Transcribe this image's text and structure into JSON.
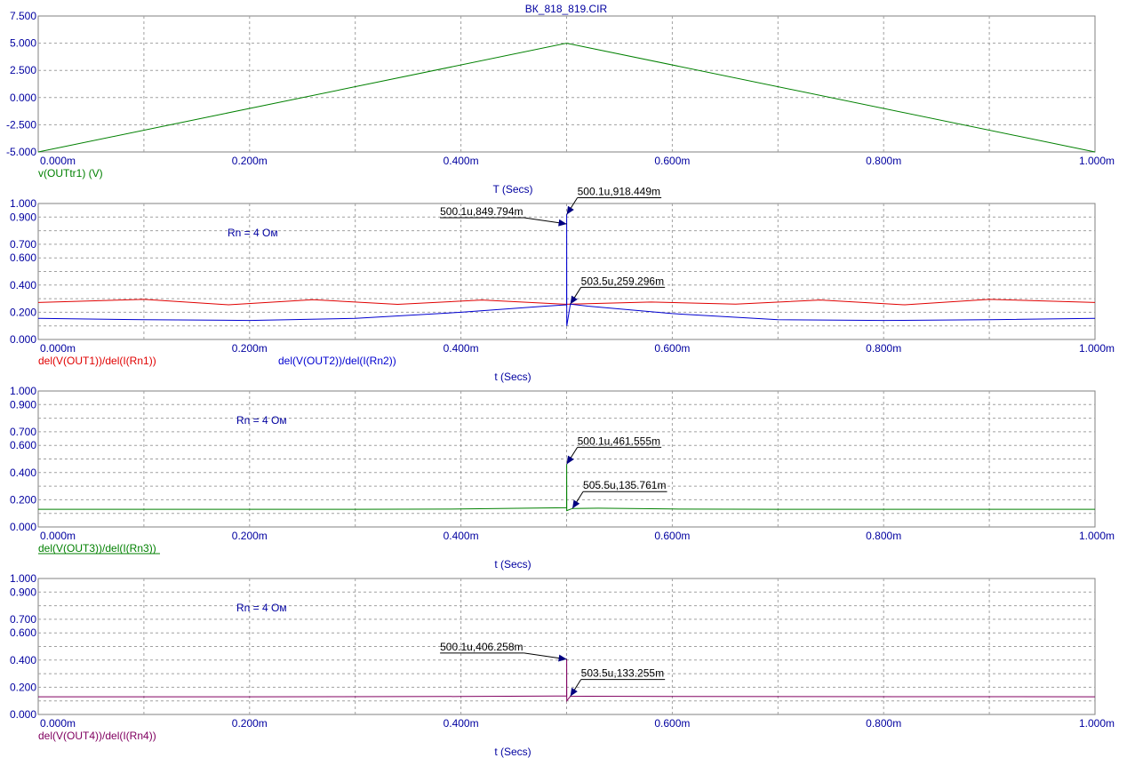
{
  "window": {
    "title": "ВК_818_819.CIR"
  },
  "chart_data": [
    {
      "type": "line",
      "title": "ВК_818_819.CIR",
      "xlabel": "T (Secs)",
      "xlim": [
        0,
        1
      ],
      "ylim": [
        -5,
        7.5
      ],
      "yticks": [
        "7.500",
        "5.000",
        "2.500",
        "0.000",
        "-2.500",
        "-5.000"
      ],
      "ytick_values": [
        7.5,
        5,
        2.5,
        0,
        -2.5,
        -5
      ],
      "xticks": [
        "0.000m",
        "0.200m",
        "0.400m",
        "0.600m",
        "0.800m",
        "1.000m"
      ],
      "xtick_values": [
        0,
        0.2,
        0.4,
        0.6,
        0.8,
        1.0
      ],
      "series": [
        {
          "name": "v(OUTtr1) (V)",
          "color": "#008000",
          "x": [
            0,
            0.5,
            1.0
          ],
          "y": [
            -5,
            5,
            -5
          ]
        }
      ],
      "annotations": []
    },
    {
      "type": "line",
      "xlabel": "t (Secs)",
      "xlim": [
        0,
        1
      ],
      "ylim": [
        0,
        1
      ],
      "yticks": [
        "1.000",
        "0.900",
        "0.700",
        "0.600",
        "0.400",
        "0.200",
        "0.000"
      ],
      "ytick_values": [
        1.0,
        0.9,
        0.7,
        0.6,
        0.4,
        0.2,
        0.0
      ],
      "xticks": [
        "0.000m",
        "0.200m",
        "0.400m",
        "0.600m",
        "0.800m",
        "1.000m"
      ],
      "xtick_values": [
        0,
        0.2,
        0.4,
        0.6,
        0.8,
        1.0
      ],
      "note": "Rn = 4 Ом",
      "series": [
        {
          "name": "del(V(OUT1))/del(I(Rn1))",
          "color": "#e00000",
          "x": [
            0,
            0.1,
            0.18,
            0.26,
            0.34,
            0.42,
            0.5,
            0.58,
            0.66,
            0.74,
            0.82,
            0.9,
            1.0
          ],
          "y": [
            0.272,
            0.295,
            0.255,
            0.292,
            0.258,
            0.29,
            0.259,
            0.275,
            0.26,
            0.29,
            0.255,
            0.295,
            0.272
          ]
        },
        {
          "name": "del(V(OUT2))/del(I(Rn2))",
          "color": "#0000d0",
          "x": [
            0,
            0.1,
            0.2,
            0.3,
            0.4,
            0.48,
            0.5,
            0.5001,
            0.5002,
            0.5035,
            0.52,
            0.6,
            0.7,
            0.8,
            0.9,
            1.0
          ],
          "y": [
            0.155,
            0.145,
            0.14,
            0.155,
            0.2,
            0.245,
            0.255,
            0.918449,
            0.1,
            0.259296,
            0.245,
            0.19,
            0.145,
            0.14,
            0.145,
            0.155
          ]
        }
      ],
      "annotations": [
        {
          "text": "500.1u,849.794m",
          "x": 0.5001,
          "y": 0.849794,
          "side": "left"
        },
        {
          "text": "500.1u,918.449m",
          "x": 0.5001,
          "y": 0.918449,
          "side": "right"
        },
        {
          "text": "503.5u,259.296m",
          "x": 0.5035,
          "y": 0.259296,
          "side": "right"
        }
      ]
    },
    {
      "type": "line",
      "xlabel": "t (Secs)",
      "xlim": [
        0,
        1
      ],
      "ylim": [
        0,
        1
      ],
      "yticks": [
        "1.000",
        "0.900",
        "0.700",
        "0.600",
        "0.400",
        "0.200",
        "0.000"
      ],
      "ytick_values": [
        1.0,
        0.9,
        0.7,
        0.6,
        0.4,
        0.2,
        0.0
      ],
      "xticks": [
        "0.000m",
        "0.200m",
        "0.400m",
        "0.600m",
        "0.800m",
        "1.000m"
      ],
      "xtick_values": [
        0,
        0.2,
        0.4,
        0.6,
        0.8,
        1.0
      ],
      "note": "Rn = 4 Ом",
      "series": [
        {
          "name": "del(V(OUT3))/del(I(Rn3))",
          "color": "#008000",
          "x": [
            0,
            0.3,
            0.4,
            0.48,
            0.5,
            0.5001,
            0.5002,
            0.5055,
            0.53,
            0.6,
            0.7,
            1.0
          ],
          "y": [
            0.13,
            0.13,
            0.132,
            0.14,
            0.142,
            0.461555,
            0.12,
            0.135761,
            0.138,
            0.132,
            0.13,
            0.13
          ]
        }
      ],
      "annotations": [
        {
          "text": "500.1u,461.555m",
          "x": 0.5001,
          "y": 0.461555,
          "side": "right"
        },
        {
          "text": "505.5u,135.761m",
          "x": 0.5055,
          "y": 0.135761,
          "side": "right"
        }
      ]
    },
    {
      "type": "line",
      "xlabel": "t (Secs)",
      "xlim": [
        0,
        1
      ],
      "ylim": [
        0,
        1
      ],
      "yticks": [
        "1.000",
        "0.900",
        "0.700",
        "0.600",
        "0.400",
        "0.200",
        "0.000"
      ],
      "ytick_values": [
        1.0,
        0.9,
        0.7,
        0.6,
        0.4,
        0.2,
        0.0
      ],
      "xticks": [
        "0.000m",
        "0.200m",
        "0.400m",
        "0.600m",
        "0.800m",
        "1.000m"
      ],
      "xtick_values": [
        0,
        0.2,
        0.4,
        0.6,
        0.8,
        1.0
      ],
      "note": "Rn = 4 Ом",
      "series": [
        {
          "name": "del(V(OUT4))/del(I(Rn4))",
          "color": "#800060",
          "x": [
            0,
            0.2,
            0.4,
            0.49,
            0.5,
            0.5001,
            0.5002,
            0.5035,
            0.52,
            0.6,
            1.0
          ],
          "y": [
            0.13,
            0.13,
            0.132,
            0.135,
            0.136,
            0.406258,
            0.1,
            0.133255,
            0.134,
            0.132,
            0.13
          ]
        }
      ],
      "annotations": [
        {
          "text": "500.1u,406.258m",
          "x": 0.5001,
          "y": 0.406258,
          "side": "left"
        },
        {
          "text": "503.5u,133.255m",
          "x": 0.5035,
          "y": 0.133255,
          "side": "right"
        }
      ]
    }
  ]
}
